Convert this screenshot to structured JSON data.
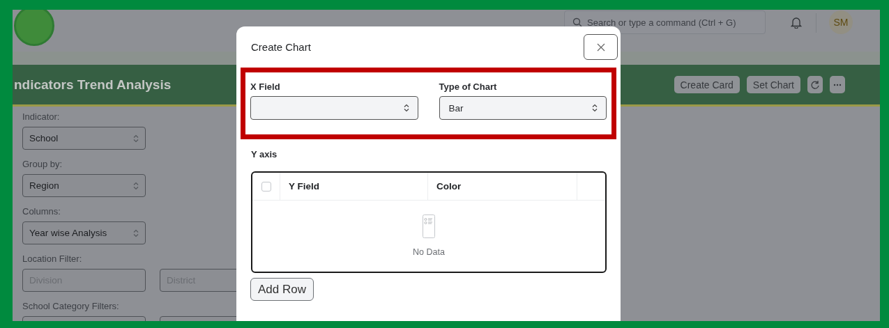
{
  "app_header": {
    "search": {
      "placeholder": "Search or type a command (Ctrl + G)"
    },
    "avatar": "SM"
  },
  "page": {
    "title": "ndicators Trend Analysis",
    "actions": [
      "Create Card",
      "Set Chart"
    ]
  },
  "filters": [
    {
      "label": "Indicator:",
      "fields": [
        {
          "kind": "select",
          "value": "School"
        }
      ]
    },
    {
      "label": "Group by:",
      "fields": [
        {
          "kind": "select",
          "value": "Region"
        }
      ]
    },
    {
      "label": "Columns:",
      "fields": [
        {
          "kind": "select",
          "value": "Year wise Analysis"
        }
      ]
    },
    {
      "label": "Location Filter:",
      "fields": [
        {
          "kind": "input",
          "placeholder": "Division"
        },
        {
          "kind": "input",
          "placeholder": "District"
        }
      ]
    },
    {
      "label": "School Category Filters:",
      "fields": [
        {
          "kind": "input"
        },
        {
          "kind": "input"
        }
      ]
    }
  ],
  "dialog": {
    "title": "Create Chart",
    "highlighted": true,
    "fields": [
      {
        "label": "X Field"
      },
      {
        "label": "Type of Chart",
        "value": "Bar"
      }
    ],
    "y_axis": {
      "label": "Y axis",
      "select_all_checked": false,
      "columns": [
        "Y Field",
        "Color"
      ],
      "empty_text": "No Data"
    },
    "add_row_button": "Add Row"
  }
}
